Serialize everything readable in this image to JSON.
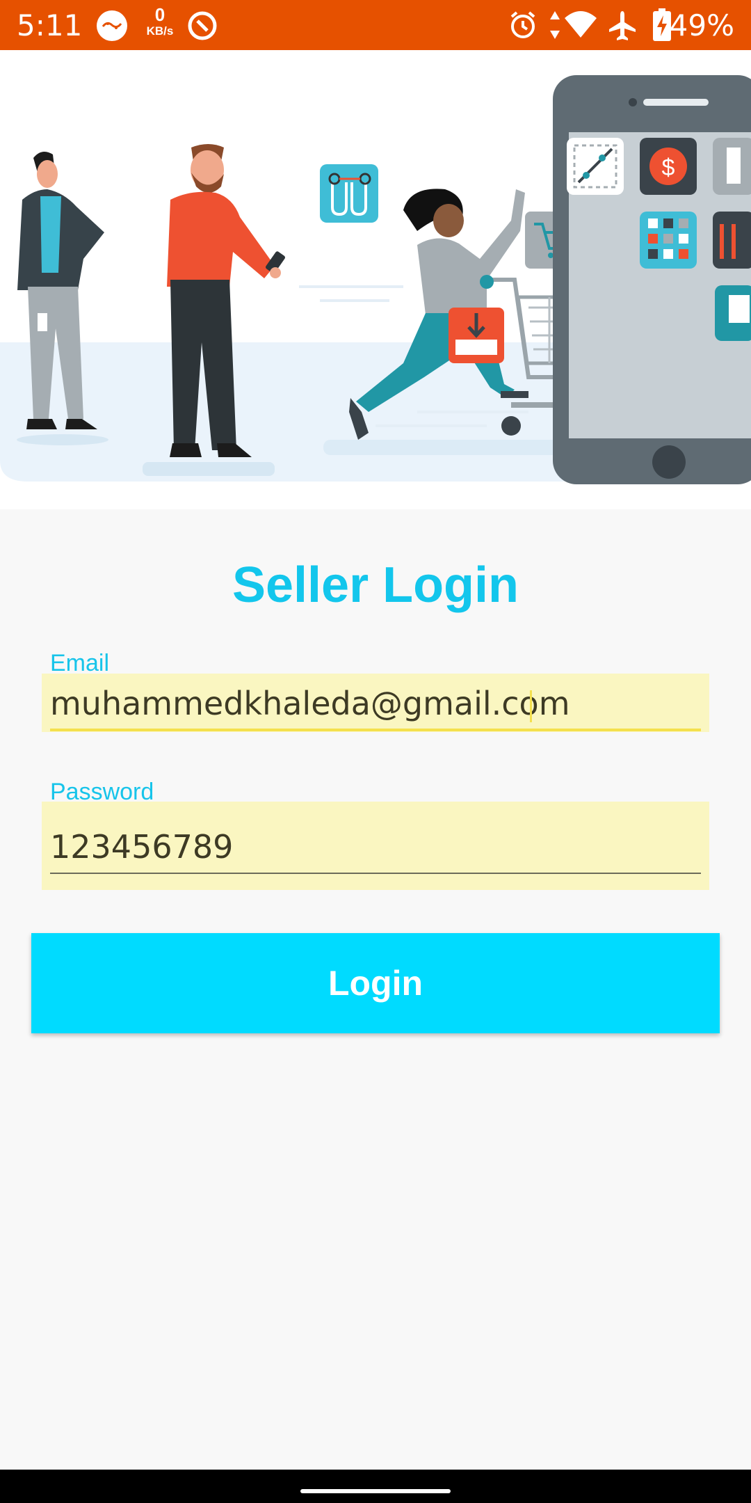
{
  "status_bar": {
    "time": "5:11",
    "net_speed_value": "0",
    "net_speed_unit": "KB/s",
    "battery": "49%",
    "icons": [
      "ring-logo-icon",
      "netspeed-icon",
      "data-saver-icon",
      "alarm-icon",
      "data-arrows-icon",
      "wifi-icon",
      "airplane-mode-icon",
      "battery-charging-icon"
    ]
  },
  "hero": {
    "illustration": "shopping-illustration"
  },
  "page": {
    "title": "Seller Login"
  },
  "form": {
    "email_label": "Email",
    "email_value": "muhammedkhaleda@gmail.com",
    "password_label": "Password",
    "password_value": "123456789",
    "login_label": "Login"
  },
  "colors": {
    "status_bar": "#e65100",
    "accent": "#13c6ec",
    "button": "#00dbff",
    "field_fill": "#faf6c1",
    "background": "#f8f8f8"
  }
}
